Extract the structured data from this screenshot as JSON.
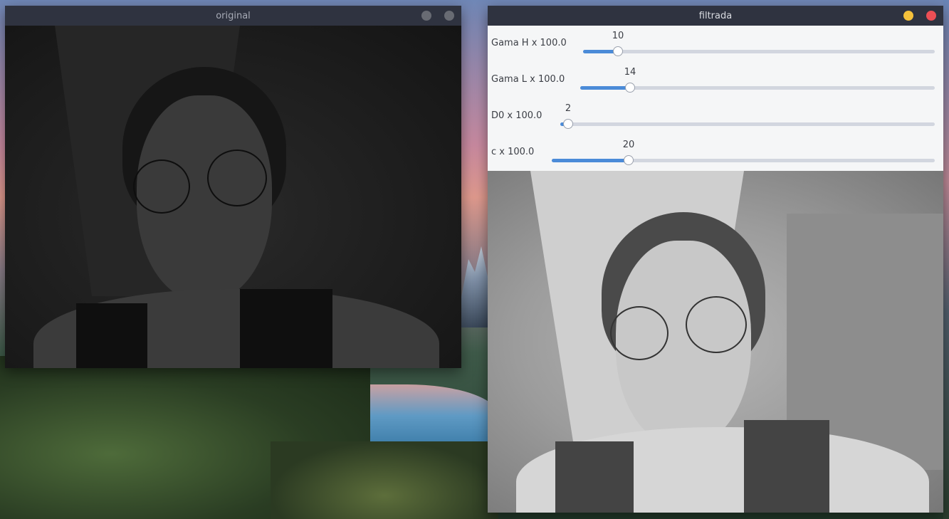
{
  "windows": {
    "original": {
      "title": "original"
    },
    "filtrada": {
      "title": "filtrada",
      "sliders": [
        {
          "label": "Gama H x 100.0",
          "value": "10",
          "fraction": 0.1
        },
        {
          "label": "Gama L x 100.0",
          "value": "14",
          "fraction": 0.14
        },
        {
          "label": "D0 x 100.0",
          "value": "2",
          "fraction": 0.02
        },
        {
          "label": "c x 100.0",
          "value": "20",
          "fraction": 0.2
        }
      ]
    }
  },
  "colors": {
    "titlebar": "#2f3340",
    "slider_fill": "#4b8bd8",
    "slider_track": "#d2d6df",
    "minimize_button": "#f5c13b",
    "close_button": "#ec4f55"
  }
}
